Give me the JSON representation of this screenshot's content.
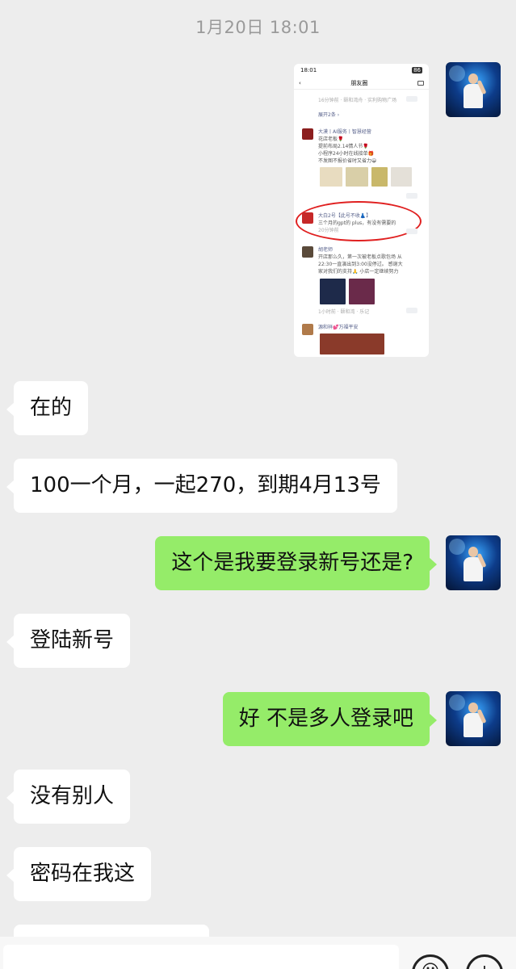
{
  "timestamp": "1月20日 18:01",
  "image_message": {
    "status_time": "18:01",
    "battery": "86",
    "nav_title": "朋友圈",
    "back_symbol": "‹",
    "top_meta": "16分钟前 · 颐和湾舟 · 实利购物广场",
    "collapse_note": "展开2条 ›",
    "post1": {
      "name": "大漠丨AI服务丨智慧经营",
      "line1": "花店老板🌹",
      "line2": "提前布局2.14情人节🌹",
      "line3": "小程序24小时在线接单🎁",
      "line4": "不发图不报价省时又省力😀"
    },
    "post2": {
      "name": "大白2号【此号不收👗】",
      "text": "三个月的gpt的 plus，有没有需要的",
      "meta": "20分钟前"
    },
    "post3": {
      "name": "胡老师",
      "line1": "开店那么久，第一次被老板点歌包场 从",
      "line2": "22:30一直演出到3:00没停过。 感谢大",
      "line3": "家对我们的支持🙏 小店一定继续努力",
      "meta": "1小时前 · 颐和湾 · 乐记"
    },
    "post4": {
      "name": "源和祥💕万福平安"
    }
  },
  "messages": [
    {
      "side": "left",
      "text": "在的"
    },
    {
      "side": "left",
      "text": "100一个月，一起270，到期4月13号"
    },
    {
      "side": "right",
      "text": "这个是我要登录新号还是?"
    },
    {
      "side": "left",
      "text": "登陆新号"
    },
    {
      "side": "right",
      "text": "好 不是多人登录吧"
    },
    {
      "side": "left",
      "text": "没有别人"
    },
    {
      "side": "left",
      "text": "密码在我这"
    }
  ],
  "input_bar": {
    "emoji_icon": "emoji-icon",
    "plus_icon": "plus-icon",
    "emoji_glyph": "☺",
    "plus_glyph": "+"
  }
}
